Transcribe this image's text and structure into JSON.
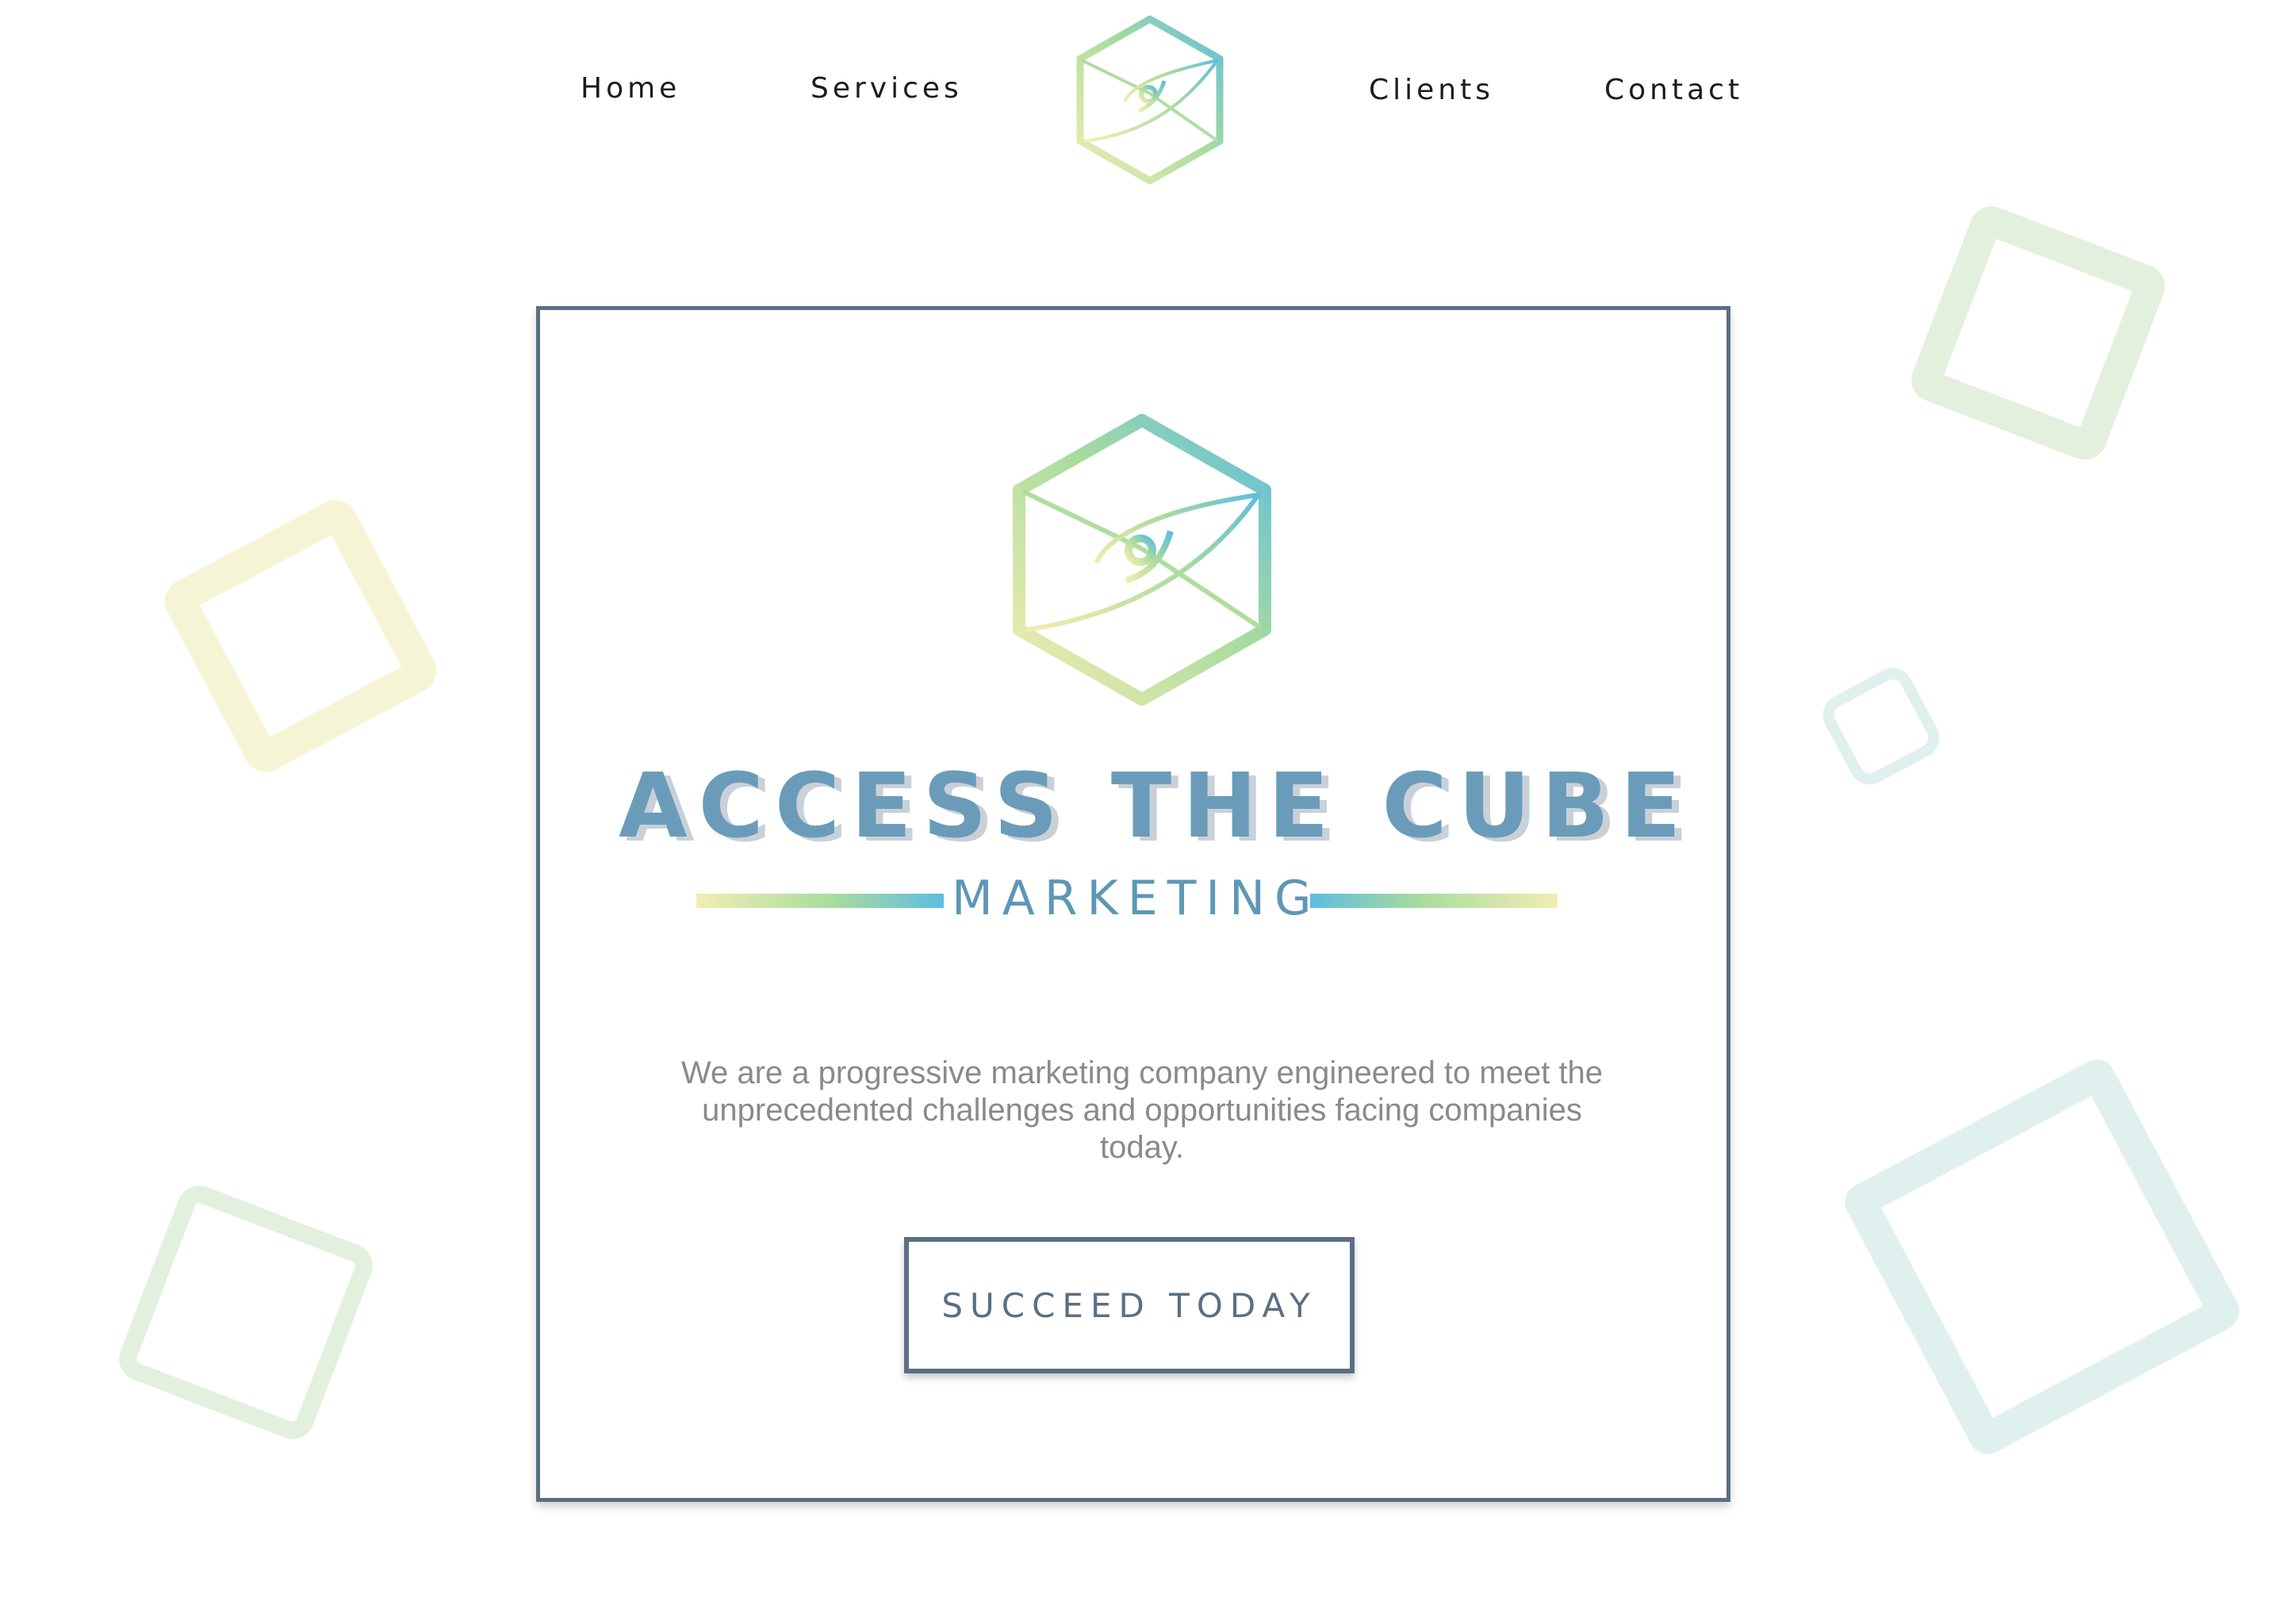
{
  "nav": {
    "home": "Home",
    "services": "Services",
    "clients": "Clients",
    "contact": "Contact"
  },
  "hero": {
    "title": "ACCESS THE CUBE",
    "subtitle": "MARKETING",
    "description": "We are a progressive marketing company engineered to meet the unprecedented challenges and opportunities facing companies today.",
    "cta_label": "SUCCEED TODAY"
  },
  "icons": {
    "nav_logo": "cube-eye-logo",
    "hero_logo": "cube-eye-logo"
  },
  "colors": {
    "border": "#5a6f84",
    "title": "#6a9cba",
    "title_shadow": "#c9d0d8",
    "gradient_yellow": "#f2edb3",
    "gradient_green": "#a9dc9d",
    "gradient_blue": "#5ebde0",
    "text_muted": "#8a8a8a"
  }
}
